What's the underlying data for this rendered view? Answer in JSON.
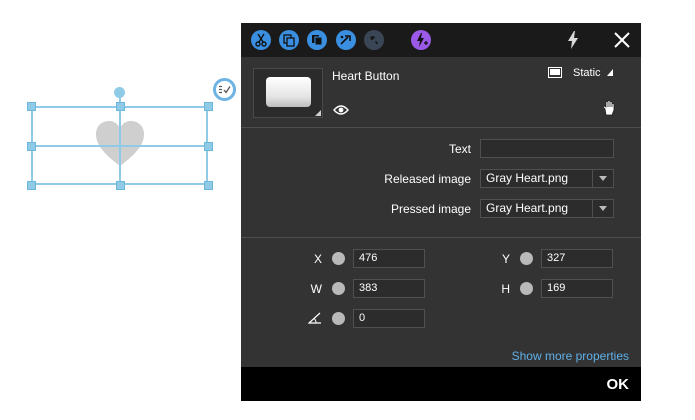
{
  "panel": {
    "widget_name": "Heart Button",
    "mode_label": "Static",
    "fields": {
      "text_label": "Text",
      "text_value": "",
      "released_label": "Released image",
      "released_value": "Gray Heart.png",
      "pressed_label": "Pressed image",
      "pressed_value": "Gray Heart.png"
    },
    "geometry": {
      "x_label": "X",
      "x_value": "476",
      "y_label": "Y",
      "y_value": "327",
      "w_label": "W",
      "w_value": "383",
      "h_label": "H",
      "h_value": "169",
      "angle_value": "0"
    },
    "more_link": "Show more properties",
    "ok_label": "OK"
  },
  "colors": {
    "accent_blue": "#3a8fe0",
    "accent_purple": "#9b59e8",
    "panel_bg": "#333333",
    "toolbar_bg": "#1a1a1a",
    "selection": "#8fcbe6",
    "link": "#5fb0e8"
  },
  "icons": [
    "cut-icon",
    "copy-icon",
    "duplicate-icon",
    "auto-actions-icon",
    "web-icon",
    "add-action-icon",
    "flash-icon",
    "close-icon",
    "eye-icon",
    "static-mode-icon",
    "hand-cursor-icon",
    "angle-icon",
    "heart-icon",
    "list-check-icon"
  ]
}
